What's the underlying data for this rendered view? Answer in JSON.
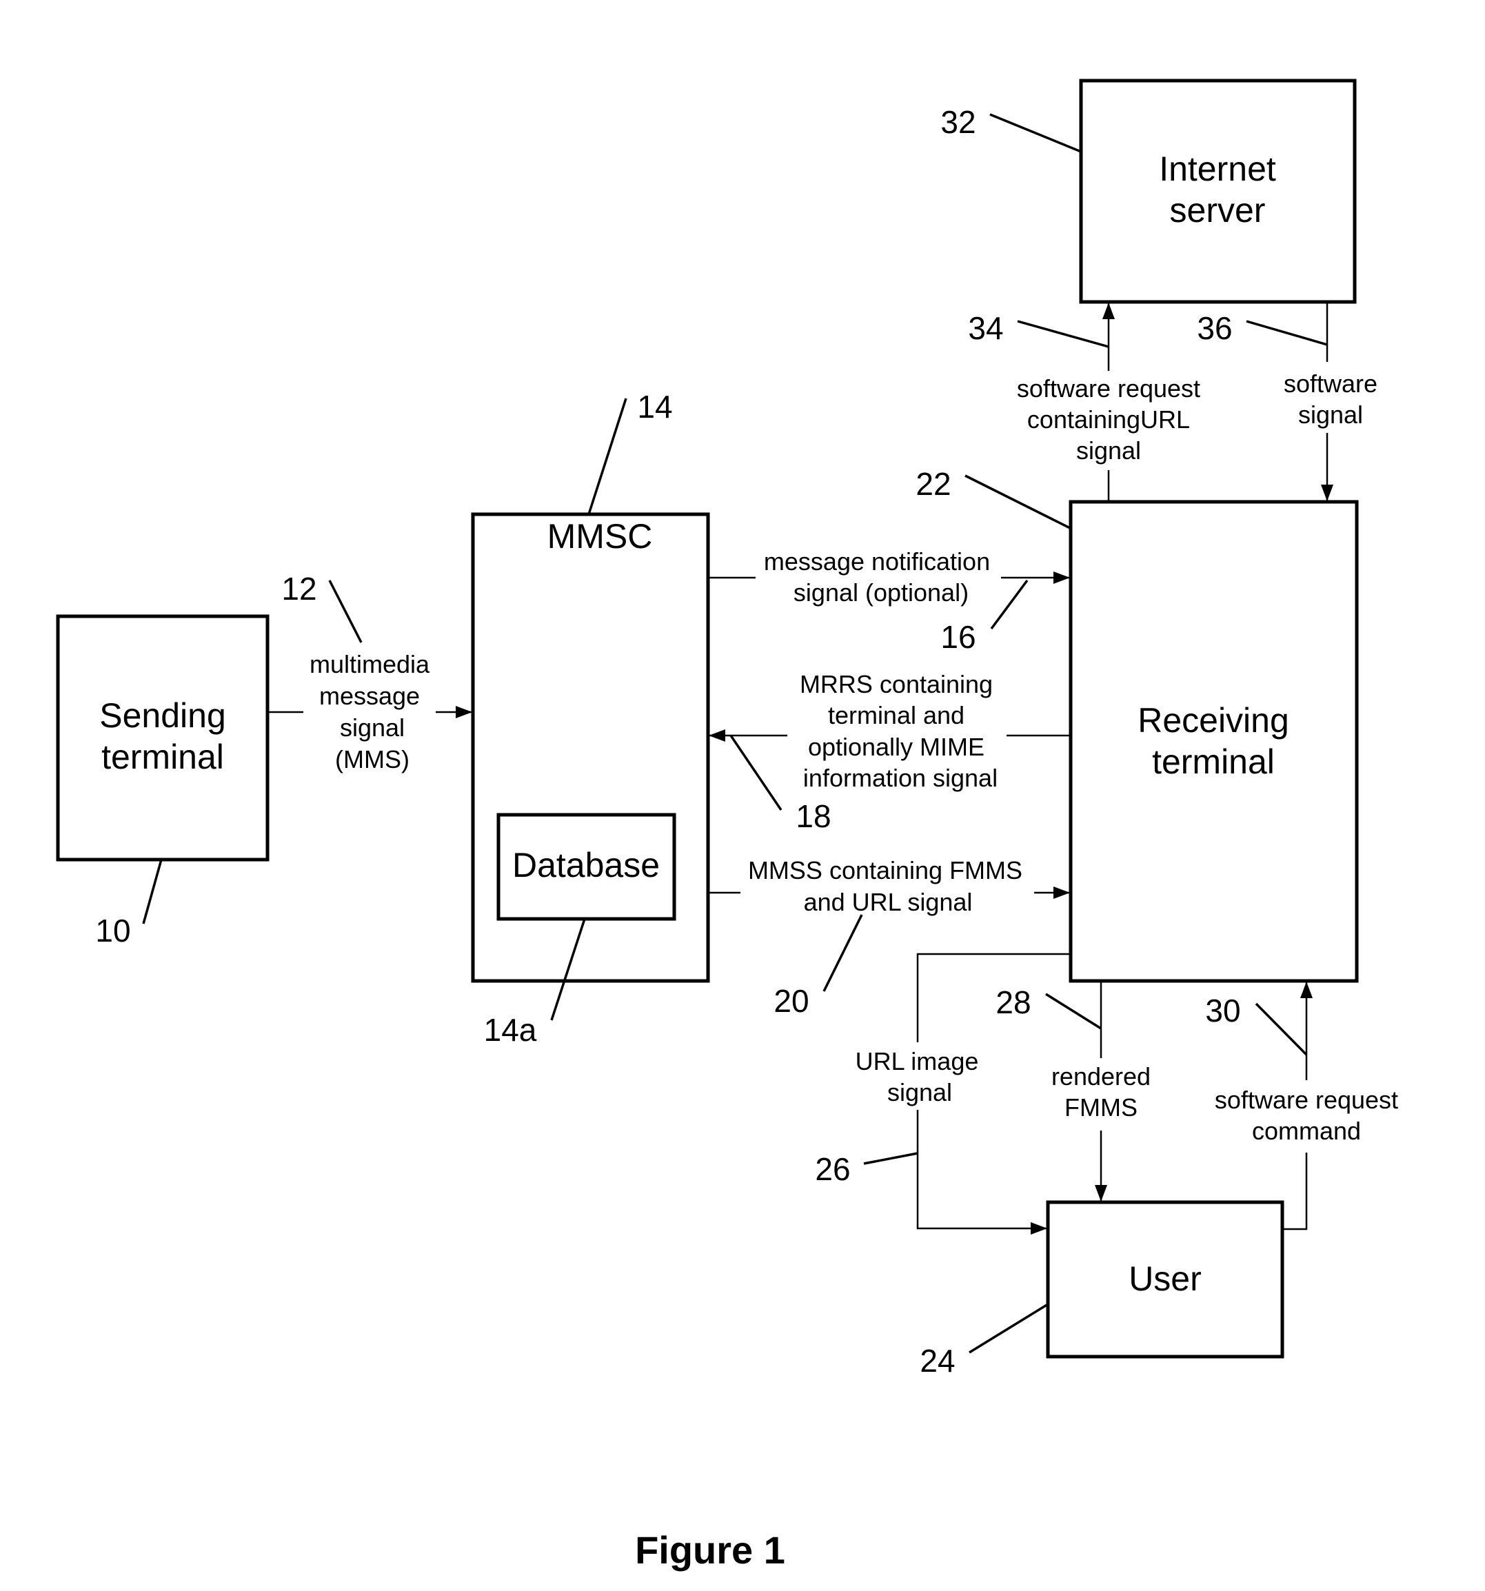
{
  "figure": {
    "caption": "Figure 1"
  },
  "blocks": {
    "sending_terminal": {
      "lines": [
        "Sending",
        "terminal"
      ],
      "ref": "10"
    },
    "mmsc": {
      "lines": [
        "MMSC"
      ],
      "ref": "14"
    },
    "database": {
      "lines": [
        "Database"
      ],
      "ref": "14a"
    },
    "receiving_terminal": {
      "lines": [
        "Receiving",
        "terminal"
      ],
      "ref": "22"
    },
    "internet_server": {
      "lines": [
        "Internet",
        "server"
      ],
      "ref": "32"
    },
    "user": {
      "lines": [
        "User"
      ],
      "ref": "24"
    }
  },
  "signals": {
    "mms": {
      "lines": [
        "multimedia",
        "message",
        "signal",
        "(MMS)"
      ],
      "ref": "12",
      "from": "Sending terminal",
      "to": "MMSC"
    },
    "notification": {
      "lines": [
        "message notification",
        "signal (optional)"
      ],
      "ref": "16",
      "from": "MMSC",
      "to": "Receiving terminal"
    },
    "mrrs": {
      "lines": [
        "MRRS containing",
        "terminal and",
        "optionally MIME",
        "information signal"
      ],
      "ref": "18",
      "from": "Receiving terminal",
      "to": "MMSC"
    },
    "mmss": {
      "lines": [
        "MMSS containing FMMS",
        "and URL signal"
      ],
      "ref": "20",
      "from": "MMSC",
      "to": "Receiving terminal"
    },
    "url_image": {
      "lines": [
        "URL image",
        "signal"
      ],
      "ref": "26",
      "from": "Receiving terminal",
      "to": "User"
    },
    "rendered": {
      "lines": [
        "rendered",
        "FMMS"
      ],
      "ref": "28",
      "from": "Receiving terminal",
      "to": "User"
    },
    "sw_request_cmd": {
      "lines": [
        "software request",
        "command"
      ],
      "ref": "30",
      "from": "User",
      "to": "Receiving terminal"
    },
    "sw_request_url": {
      "lines": [
        "software request",
        "containingURL",
        "signal"
      ],
      "ref": "34",
      "from": "Receiving terminal",
      "to": "Internet server"
    },
    "sw_signal": {
      "lines": [
        "software",
        "signal"
      ],
      "ref": "36",
      "from": "Internet server",
      "to": "Receiving terminal"
    }
  }
}
